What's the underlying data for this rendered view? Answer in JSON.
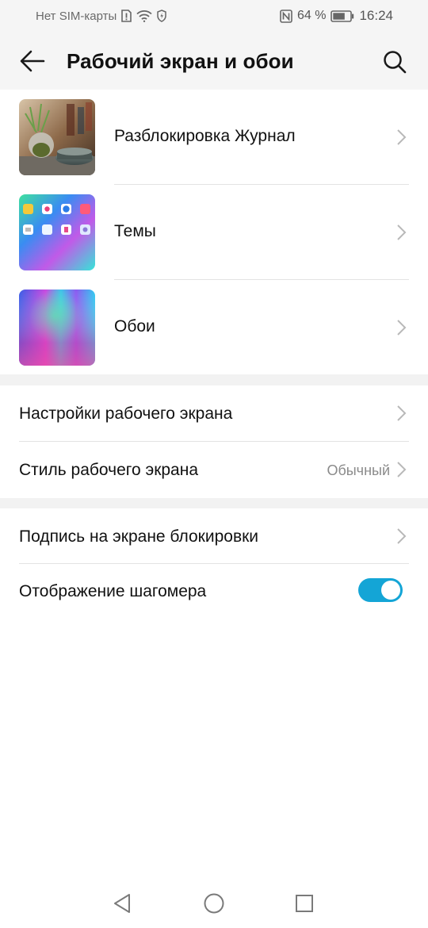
{
  "status_bar": {
    "carrier": "Нет SIM-карты",
    "battery_percent": "64 %",
    "time": "16:24",
    "icons": [
      "sim-alert-icon",
      "wifi-icon",
      "battery-saver-icon",
      "nfc-icon",
      "battery-icon"
    ]
  },
  "header": {
    "title": "Рабочий экран и обои",
    "back_icon": "back-arrow-icon",
    "search_icon": "search-icon"
  },
  "media_items": [
    {
      "label": "Разблокировка Журнал",
      "thumb": "magazine-unlock-thumbnail"
    },
    {
      "label": "Темы",
      "thumb": "themes-thumbnail"
    },
    {
      "label": "Обои",
      "thumb": "wallpaper-thumbnail"
    }
  ],
  "home_settings": [
    {
      "label": "Настройки рабочего экрана",
      "value": ""
    },
    {
      "label": "Стиль рабочего экрана",
      "value": "Обычный"
    }
  ],
  "lock_settings": [
    {
      "label": "Подпись на экране блокировки"
    },
    {
      "label": "Отображение шагомера",
      "toggle_on": true
    }
  ],
  "colors": {
    "accent": "#14a5d6",
    "header_bg": "#f5f5f5",
    "section_gap": "#f2f2f2"
  },
  "nav_bar": {
    "icons": [
      "nav-back-icon",
      "nav-home-icon",
      "nav-recents-icon"
    ]
  }
}
